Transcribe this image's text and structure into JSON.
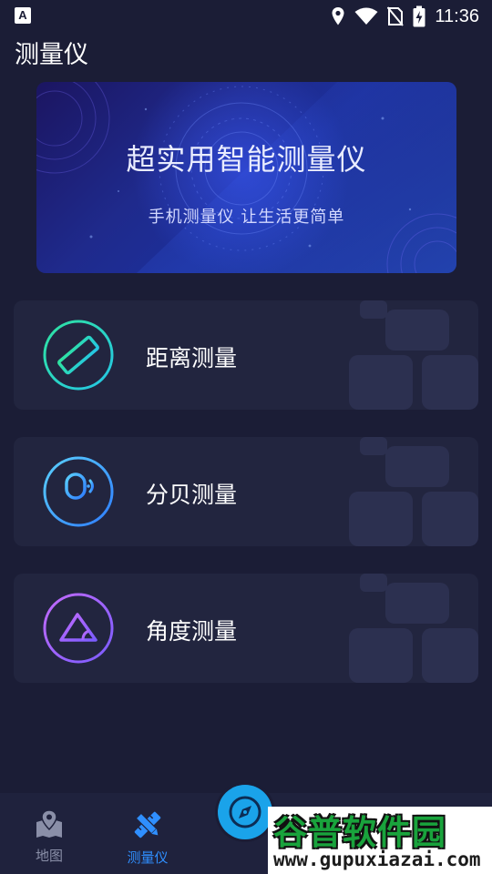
{
  "status_bar": {
    "time": "11:36",
    "app_badge": "A"
  },
  "header": {
    "title": "测量仪"
  },
  "banner": {
    "title": "超实用智能测量仪",
    "subtitle": "手机测量仪 让生活更简单"
  },
  "cards": [
    {
      "label": "距离测量",
      "icon": "ruler-icon"
    },
    {
      "label": "分贝测量",
      "icon": "microphone-icon"
    },
    {
      "label": "角度测量",
      "icon": "triangle-angle-icon"
    }
  ],
  "bottom_nav": {
    "items": [
      {
        "label": "地图",
        "icon": "map-pin-icon",
        "active": false
      },
      {
        "label": "测量仪",
        "icon": "pencil-ruler-icon",
        "active": true
      }
    ],
    "center_button_icon": "compass-icon",
    "active_color": "#2f8fff",
    "inactive_color": "#8a8fa8"
  },
  "watermark": {
    "name": "谷普软件园",
    "url": "www.gupuxiazai.com"
  }
}
